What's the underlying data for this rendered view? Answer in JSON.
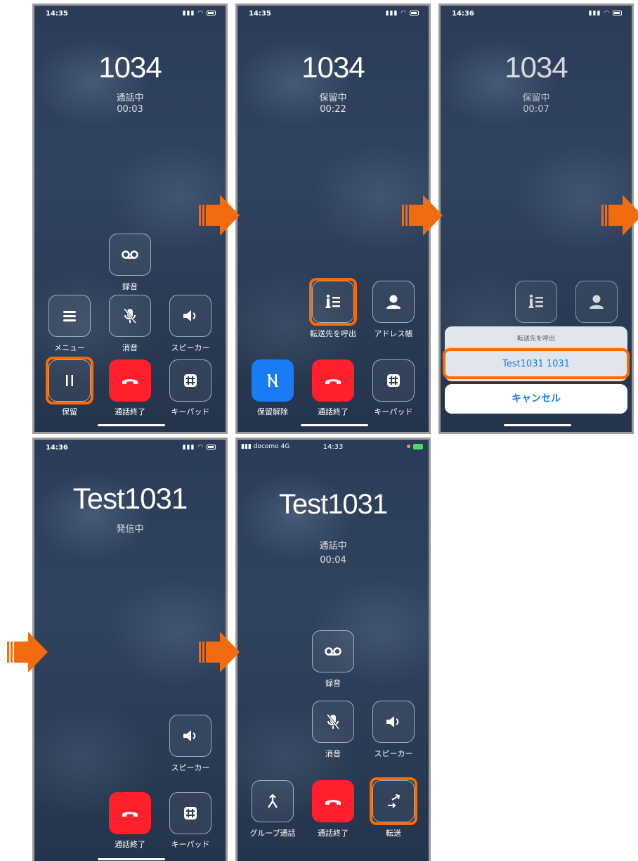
{
  "screens": [
    {
      "status_time": "14:35",
      "callee": "1034",
      "state": "通話中",
      "timer": "00:03",
      "buttons": {
        "record": "録音",
        "menu": "メニュー",
        "mute": "消音",
        "speaker": "スピーカー",
        "hold": "保留",
        "end_call": "通話終了",
        "keypad": "キーパッド"
      }
    },
    {
      "status_time": "14:35",
      "callee": "1034",
      "state": "保留中",
      "timer": "00:22",
      "buttons": {
        "call_transfer_target": "転送先を呼出",
        "address_book": "アドレス帳",
        "unhold": "保留解除",
        "end_call": "通話終了",
        "keypad": "キーパッド"
      }
    },
    {
      "status_time": "14:36",
      "callee": "1034",
      "state": "保留中",
      "timer": "00:07",
      "sheet": {
        "title": "転送先を呼出",
        "option": "Test1031 1031",
        "cancel": "キャンセル"
      }
    },
    {
      "status_time": "14:36",
      "callee": "Test1031",
      "state": "発信中",
      "buttons": {
        "speaker": "スピーカー",
        "end_call": "通話終了",
        "keypad": "キーパッド"
      }
    },
    {
      "carrier": "docomo",
      "network": "4G",
      "status_time": "14:33",
      "callee": "Test1031",
      "state": "通話中",
      "timer": "00:04",
      "buttons": {
        "record": "録音",
        "mute": "消音",
        "speaker": "スピーカー",
        "group_call": "グループ通話",
        "end_call": "通話終了",
        "transfer": "転送"
      }
    }
  ],
  "colors": {
    "highlight": "#ff6a00",
    "end_call_red": "#ff1f2d",
    "unhold_blue": "#1a7cf5",
    "arrow_orange": "#f26b0f"
  }
}
